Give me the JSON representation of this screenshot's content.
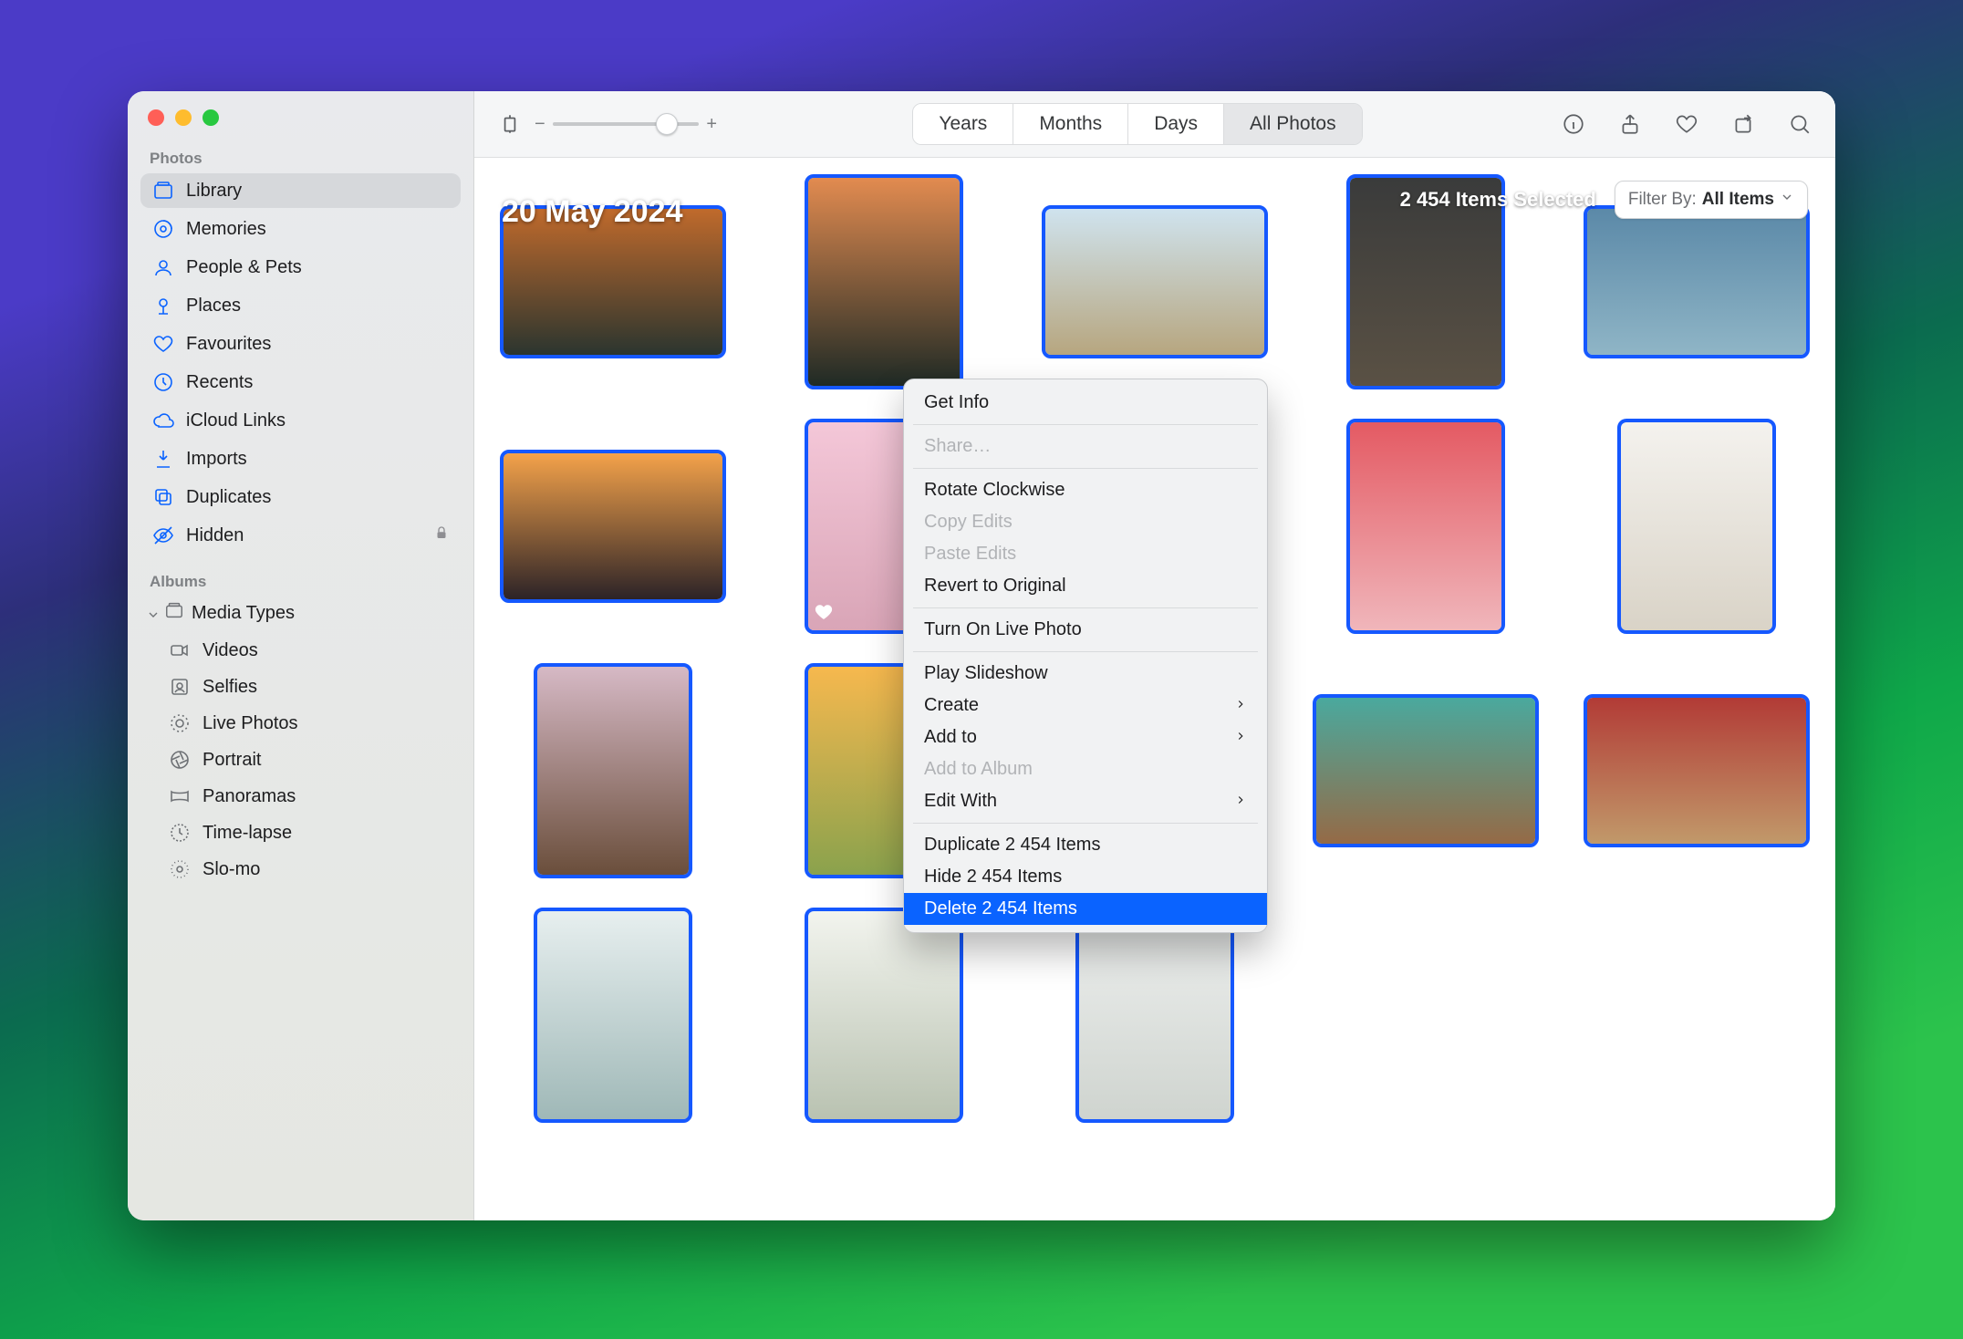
{
  "sidebar": {
    "sections": {
      "photos_title": "Photos",
      "albums_title": "Albums"
    },
    "items": {
      "library": "Library",
      "memories": "Memories",
      "people_pets": "People & Pets",
      "places": "Places",
      "favourites": "Favourites",
      "recents": "Recents",
      "icloud_links": "iCloud Links",
      "imports": "Imports",
      "duplicates": "Duplicates",
      "hidden": "Hidden"
    },
    "media_types_label": "Media Types",
    "media_types": {
      "videos": "Videos",
      "selfies": "Selfies",
      "live_photos": "Live Photos",
      "portrait": "Portrait",
      "panoramas": "Panoramas",
      "time_lapse": "Time-lapse",
      "slo_mo": "Slo-mo"
    }
  },
  "toolbar": {
    "zoom_minus": "−",
    "zoom_plus": "+",
    "seg": {
      "years": "Years",
      "months": "Months",
      "days": "Days",
      "all": "All Photos"
    }
  },
  "grid": {
    "date_label": "20 May 2024",
    "selection_status": "2 454 Items Selected",
    "filter_label": "Filter By:",
    "filter_value": "All Items"
  },
  "thumbs": [
    {
      "shape": "w",
      "bg": "linear-gradient(#c06a2c,#2b352f)"
    },
    {
      "shape": "p",
      "bg": "linear-gradient(#e28b50,#1f2a25)"
    },
    {
      "shape": "w",
      "bg": "linear-gradient(#cfe3ee,#b7a67f)"
    },
    {
      "shape": "p",
      "bg": "linear-gradient(#3a3b3b,#5a5144)"
    },
    {
      "shape": "w",
      "bg": "linear-gradient(#5b89a8,#8fb5c6)"
    },
    {
      "shape": "w",
      "bg": "linear-gradient(#f4a24a,#2c2327)",
      "fav": false
    },
    {
      "shape": "p",
      "bg": "linear-gradient(#f4c7d8,#d9a5b7)",
      "fav": true
    },
    {
      "shape": "p",
      "bg": "linear-gradient(#f2ede7,#e3d5bd)"
    },
    {
      "shape": "p",
      "bg": "linear-gradient(#e45a63,#f0b6bb)"
    },
    {
      "shape": "p",
      "bg": "linear-gradient(#f4f2ee,#d9d3c7)"
    },
    {
      "shape": "p",
      "bg": "linear-gradient(#d6b9c5,#6a4e3b)"
    },
    {
      "shape": "p",
      "bg": "linear-gradient(#f6b84e,#8aa24d)"
    },
    {
      "shape": "w",
      "bg": "linear-gradient(#efc58a,#5bbfa0)"
    },
    {
      "shape": "w",
      "bg": "linear-gradient(#4aa99e,#956a46)"
    },
    {
      "shape": "w",
      "bg": "linear-gradient(#b23b36,#c1996a)"
    },
    {
      "shape": "p",
      "bg": "linear-gradient(#e7efef,#9fb8b7)"
    },
    {
      "shape": "p",
      "bg": "linear-gradient(#f2f4ee,#b9c2b1)"
    },
    {
      "shape": "p",
      "bg": "linear-gradient(#eef0ef,#cfd4cf)"
    }
  ],
  "context_menu": [
    {
      "label": "Get Info",
      "type": "item"
    },
    {
      "type": "sep"
    },
    {
      "label": "Share…",
      "type": "item",
      "disabled": true
    },
    {
      "type": "sep"
    },
    {
      "label": "Rotate Clockwise",
      "type": "item"
    },
    {
      "label": "Copy Edits",
      "type": "item",
      "disabled": true
    },
    {
      "label": "Paste Edits",
      "type": "item",
      "disabled": true
    },
    {
      "label": "Revert to Original",
      "type": "item"
    },
    {
      "type": "sep"
    },
    {
      "label": "Turn On Live Photo",
      "type": "item"
    },
    {
      "type": "sep"
    },
    {
      "label": "Play Slideshow",
      "type": "item"
    },
    {
      "label": "Create",
      "type": "item",
      "submenu": true
    },
    {
      "label": "Add to",
      "type": "item",
      "submenu": true
    },
    {
      "label": "Add to Album",
      "type": "item",
      "disabled": true
    },
    {
      "label": "Edit With",
      "type": "item",
      "submenu": true
    },
    {
      "type": "sep"
    },
    {
      "label": "Duplicate 2 454 Items",
      "type": "item"
    },
    {
      "label": "Hide 2 454 Items",
      "type": "item"
    },
    {
      "label": "Delete 2 454 Items",
      "type": "item",
      "highlight": true
    }
  ]
}
